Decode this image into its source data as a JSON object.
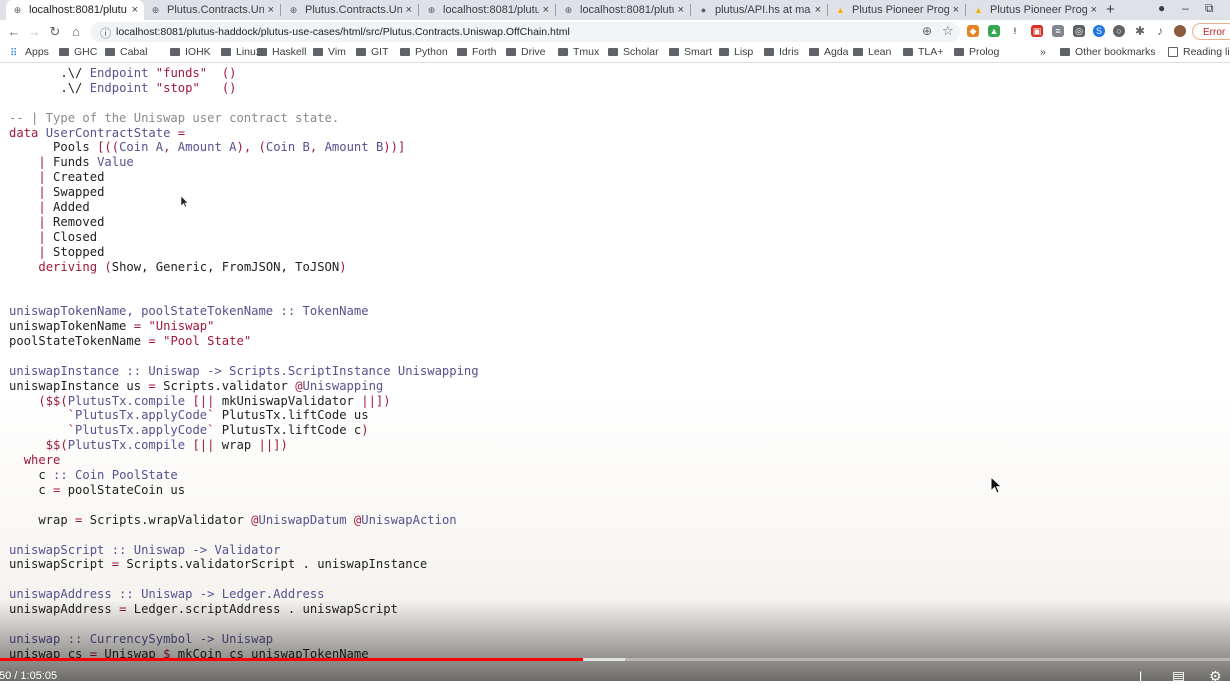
{
  "browser": {
    "tabs": [
      {
        "title": "localhost:8081/plutu",
        "active": true,
        "icon": "globe-icon"
      },
      {
        "title": "Plutus.Contracts.Uni",
        "active": false,
        "icon": "globe-icon"
      },
      {
        "title": "Plutus.Contracts.Uni",
        "active": false,
        "icon": "globe-icon"
      },
      {
        "title": "localhost:8081/plutu",
        "active": false,
        "icon": "globe-icon"
      },
      {
        "title": "localhost:8081/plutu",
        "active": false,
        "icon": "globe-icon"
      },
      {
        "title": "plutus/API.hs at mas",
        "active": false,
        "icon": "github-icon"
      },
      {
        "title": "Plutus Pioneer Progr",
        "active": false,
        "icon": "drive-icon"
      },
      {
        "title": "Plutus Pioneer Progr",
        "active": false,
        "icon": "drive-icon"
      }
    ],
    "new_tab_label": "+",
    "url": "localhost:8081/plutus-haddock/plutus-use-cases/html/src/Plutus.Contracts.Uniswap.OffChain.html",
    "error_label": "Error",
    "bookmarks": [
      "Apps",
      "GHC",
      "Cabal",
      "IOHK",
      "Linux",
      "Haskell",
      "Vim",
      "GIT",
      "Python",
      "Forth",
      "Drive",
      "Tmux",
      "Scholar",
      "Smart",
      "Lisp",
      "Idris",
      "Agda",
      "Lean",
      "TLA+",
      "Prolog"
    ],
    "more_bookmarks": "»",
    "other_bookmarks": "Other bookmarks",
    "reading_list": "Reading lis"
  },
  "code": {
    "lines": [
      [
        [
          "pl",
          "       .\\/ "
        ],
        [
          "ty",
          "Endpoint"
        ],
        [
          "pl",
          " "
        ],
        [
          "str",
          "\"funds\""
        ],
        [
          "pl",
          "  "
        ],
        [
          "op",
          "()"
        ]
      ],
      [
        [
          "pl",
          "       .\\/ "
        ],
        [
          "ty",
          "Endpoint"
        ],
        [
          "pl",
          " "
        ],
        [
          "str",
          "\"stop\""
        ],
        [
          "pl",
          "   "
        ],
        [
          "op",
          "()"
        ]
      ],
      [
        [
          "pl",
          ""
        ]
      ],
      [
        [
          "com",
          "-- | Type of the Uniswap user contract state."
        ]
      ],
      [
        [
          "kw",
          "data"
        ],
        [
          "pl",
          " "
        ],
        [
          "ty",
          "UserContractState"
        ],
        [
          "pl",
          " "
        ],
        [
          "op",
          "="
        ]
      ],
      [
        [
          "pl",
          "      Pools "
        ],
        [
          "op",
          "[(("
        ],
        [
          "ty",
          "Coin A"
        ],
        [
          "op",
          ", "
        ],
        [
          "ty",
          "Amount A"
        ],
        [
          "op",
          "), ("
        ],
        [
          "ty",
          "Coin B"
        ],
        [
          "op",
          ", "
        ],
        [
          "ty",
          "Amount B"
        ],
        [
          "op",
          "))]"
        ]
      ],
      [
        [
          "pl",
          "    "
        ],
        [
          "op",
          "|"
        ],
        [
          "pl",
          " Funds "
        ],
        [
          "ty",
          "Value"
        ]
      ],
      [
        [
          "pl",
          "    "
        ],
        [
          "op",
          "|"
        ],
        [
          "pl",
          " Created"
        ]
      ],
      [
        [
          "pl",
          "    "
        ],
        [
          "op",
          "|"
        ],
        [
          "pl",
          " Swapped"
        ]
      ],
      [
        [
          "pl",
          "    "
        ],
        [
          "op",
          "|"
        ],
        [
          "pl",
          " Added"
        ]
      ],
      [
        [
          "pl",
          "    "
        ],
        [
          "op",
          "|"
        ],
        [
          "pl",
          " Removed"
        ]
      ],
      [
        [
          "pl",
          "    "
        ],
        [
          "op",
          "|"
        ],
        [
          "pl",
          " Closed"
        ]
      ],
      [
        [
          "pl",
          "    "
        ],
        [
          "op",
          "|"
        ],
        [
          "pl",
          " Stopped"
        ]
      ],
      [
        [
          "pl",
          "    "
        ],
        [
          "kw",
          "deriving"
        ],
        [
          "pl",
          " "
        ],
        [
          "op",
          "("
        ],
        [
          "pl",
          "Show, Generic, FromJSON, ToJSON"
        ],
        [
          "op",
          ")"
        ]
      ],
      [
        [
          "pl",
          ""
        ]
      ],
      [
        [
          "pl",
          ""
        ]
      ],
      [
        [
          "ty",
          "uniswapTokenName, poolStateTokenName :: TokenName"
        ]
      ],
      [
        [
          "pl",
          "uniswapTokenName "
        ],
        [
          "op",
          "="
        ],
        [
          "pl",
          " "
        ],
        [
          "str",
          "\"Uniswap\""
        ]
      ],
      [
        [
          "pl",
          "poolStateTokenName "
        ],
        [
          "op",
          "="
        ],
        [
          "pl",
          " "
        ],
        [
          "str",
          "\"Pool State\""
        ]
      ],
      [
        [
          "pl",
          ""
        ]
      ],
      [
        [
          "ty",
          "uniswapInstance :: Uniswap -> Scripts.ScriptInstance Uniswapping"
        ]
      ],
      [
        [
          "pl",
          "uniswapInstance us "
        ],
        [
          "op",
          "="
        ],
        [
          "pl",
          " Scripts.validator "
        ],
        [
          "op",
          "@"
        ],
        [
          "ty",
          "Uniswapping"
        ]
      ],
      [
        [
          "pl",
          "    "
        ],
        [
          "op",
          "($$("
        ],
        [
          "ty",
          "PlutusTx.compile"
        ],
        [
          "pl",
          " "
        ],
        [
          "op",
          "[||"
        ],
        [
          "pl",
          " mkUniswapValidator "
        ],
        [
          "op",
          "||]"
        ],
        [
          "op",
          ")"
        ]
      ],
      [
        [
          "pl",
          "        "
        ],
        [
          "op",
          "`"
        ],
        [
          "ty",
          "PlutusTx.applyCode"
        ],
        [
          "op",
          "`"
        ],
        [
          "pl",
          " PlutusTx.liftCode us"
        ]
      ],
      [
        [
          "pl",
          "        "
        ],
        [
          "op",
          "`"
        ],
        [
          "ty",
          "PlutusTx.applyCode"
        ],
        [
          "op",
          "`"
        ],
        [
          "pl",
          " PlutusTx.liftCode c"
        ],
        [
          "op",
          ")"
        ]
      ],
      [
        [
          "pl",
          "     "
        ],
        [
          "op",
          "$$("
        ],
        [
          "ty",
          "PlutusTx.compile"
        ],
        [
          "pl",
          " "
        ],
        [
          "op",
          "[||"
        ],
        [
          "pl",
          " wrap "
        ],
        [
          "op",
          "||])"
        ]
      ],
      [
        [
          "pl",
          "  "
        ],
        [
          "kw",
          "where"
        ]
      ],
      [
        [
          "pl",
          "    c "
        ],
        [
          "ty",
          ":: Coin PoolState"
        ]
      ],
      [
        [
          "pl",
          "    c "
        ],
        [
          "op",
          "="
        ],
        [
          "pl",
          " poolStateCoin us"
        ]
      ],
      [
        [
          "pl",
          ""
        ]
      ],
      [
        [
          "pl",
          "    wrap "
        ],
        [
          "op",
          "="
        ],
        [
          "pl",
          " Scripts.wrapValidator "
        ],
        [
          "op",
          "@"
        ],
        [
          "ty",
          "UniswapDatum"
        ],
        [
          "pl",
          " "
        ],
        [
          "op",
          "@"
        ],
        [
          "ty",
          "UniswapAction"
        ]
      ],
      [
        [
          "pl",
          ""
        ]
      ],
      [
        [
          "ty",
          "uniswapScript :: Uniswap -> Validator"
        ]
      ],
      [
        [
          "pl",
          "uniswapScript "
        ],
        [
          "op",
          "="
        ],
        [
          "pl",
          " Scripts.validatorScript . uniswapInstance"
        ]
      ],
      [
        [
          "pl",
          ""
        ]
      ],
      [
        [
          "ty",
          "uniswapAddress :: Uniswap -> Ledger.Address"
        ]
      ],
      [
        [
          "pl",
          "uniswapAddress "
        ],
        [
          "op",
          "="
        ],
        [
          "pl",
          " Ledger.scriptAddress . uniswapScript"
        ]
      ],
      [
        [
          "pl",
          ""
        ]
      ],
      [
        [
          "ty",
          "uniswap :: CurrencySymbol -> Uniswap"
        ]
      ],
      [
        [
          "pl",
          "uniswap cs "
        ],
        [
          "op",
          "="
        ],
        [
          "pl",
          " Uniswap "
        ],
        [
          "op",
          "$"
        ],
        [
          "pl",
          " mkCoin cs uniswapTokenName"
        ]
      ]
    ]
  },
  "video": {
    "time": "50 / 1:05:05",
    "progress_fraction": 0.474,
    "buffered_fraction": 0.508
  },
  "colors": {
    "keyword": "#a0183c",
    "type": "#5a5090",
    "comment": "#8a8a8a",
    "progress": "#ff0000"
  }
}
